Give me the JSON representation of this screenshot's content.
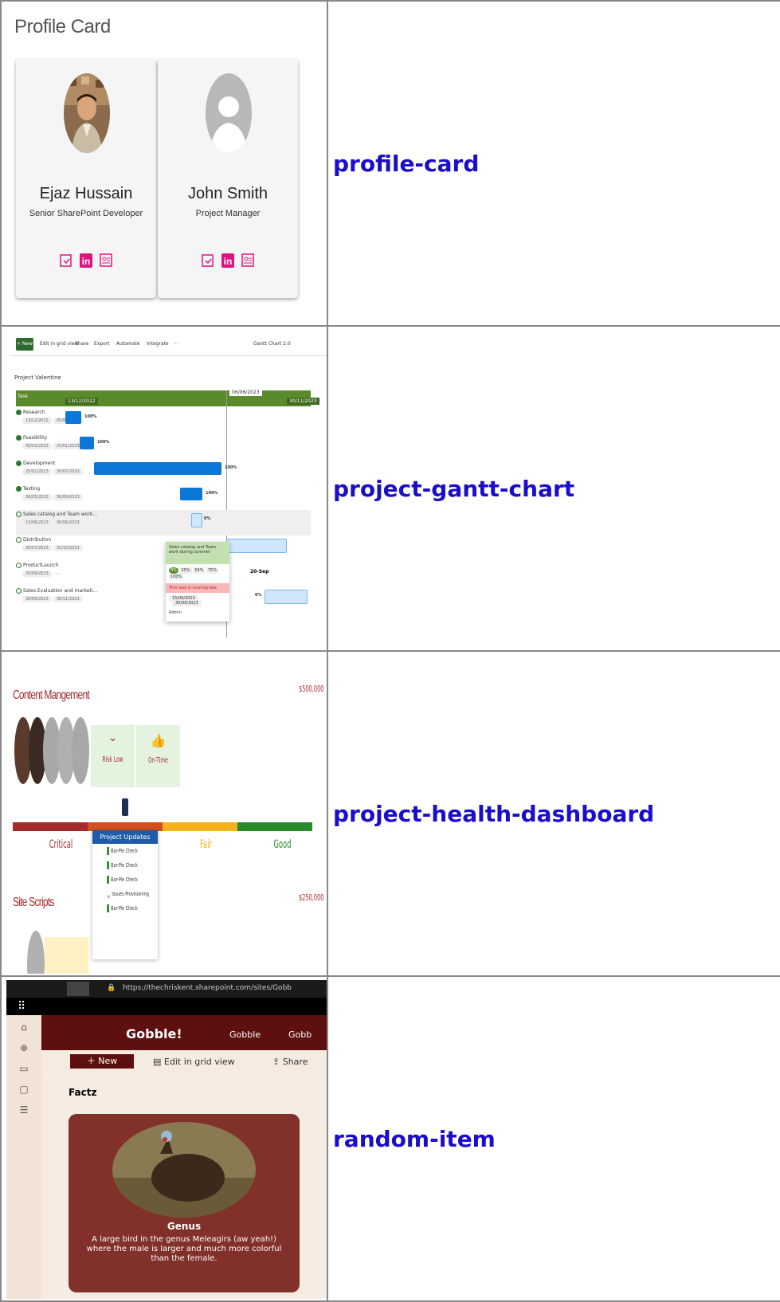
{
  "rows": [
    {
      "link": "profile-card"
    },
    {
      "link": "project-gantt-chart"
    },
    {
      "link": "project-health-dashboard"
    },
    {
      "link": "random-item"
    }
  ],
  "profile": {
    "title": "Profile Card",
    "cards": [
      {
        "name": "Ejaz Hussain",
        "role": "Senior SharePoint Developer"
      },
      {
        "name": "John Smith",
        "role": "Project Manager"
      }
    ]
  },
  "gantt": {
    "toolbar": {
      "new": "+ New",
      "edit": "Edit in grid view",
      "share": "Share",
      "export": "Export",
      "automate": "Automate",
      "integrate": "Integrate",
      "more": "···",
      "view": "Gantt Chart 2.0"
    },
    "project": "Project Valentine",
    "header": {
      "task": "Task",
      "d1": "13/12/2022",
      "d2": "06/06/2023",
      "d3": "30/11/2023"
    },
    "tasks": [
      {
        "name": "Research",
        "start": "13/12/2022",
        "end": "05/01/2023",
        "pct": "100%"
      },
      {
        "name": "Feasibility",
        "start": "05/01/2023",
        "end": "25/01/2023",
        "pct": "100%"
      },
      {
        "name": "Development",
        "start": "25/01/2023",
        "end": "30/07/2023",
        "pct": "100%"
      },
      {
        "name": "Testing",
        "start": "30/05/2023",
        "end": "30/06/2023",
        "pct": "100%"
      },
      {
        "name": "Sales catalog and Team work...",
        "start": "15/06/2023",
        "end": "30/06/2023",
        "pct": "0%"
      },
      {
        "name": "Distribution",
        "start": "30/07/2023",
        "end": "31/10/2023",
        "pct": ""
      },
      {
        "name": "ProductLaunch",
        "start": "20/09/2023",
        "end": "",
        "pct": ""
      },
      {
        "name": "Sales Evaluation and marketi...",
        "start": "30/09/2023",
        "end": "30/11/2023",
        "pct": "0%"
      }
    ],
    "milestone": "20-Sep",
    "popup": {
      "title": "Sales catalog and Team work during summer",
      "options": [
        "0%",
        "25%",
        "50%",
        "75%",
        "100%"
      ],
      "warning": "This task is running late",
      "start": "15/06/2023",
      "end": "30/06/2023",
      "owner": "Admin"
    }
  },
  "health": {
    "project1": {
      "title": "Content Mangement",
      "amount": "$500,000",
      "risk": "Risk Low",
      "time": "On-Time"
    },
    "scale": [
      "Critical",
      "Fair",
      "Good"
    ],
    "updates": {
      "title": "Project Updates",
      "lines": [
        "Bar-Pie Check",
        "Bar-Pie Check",
        "Bar-Pie Check",
        "Issues Provisioning",
        "Bar-Pie Check"
      ]
    },
    "project2": {
      "title": "Site Scripts",
      "amount": "$250,000"
    },
    "colors": {
      "critical": "#a52a2a",
      "poor": "#d2501c",
      "fair": "#f5b21c",
      "good": "#2a8a2a"
    }
  },
  "random": {
    "url": "https://thechriskent.sharepoint.com/sites/Gobb",
    "site": "Gobble!",
    "nav": [
      "Gobble",
      "Gobb"
    ],
    "cmd": {
      "new": "New",
      "edit": "Edit in grid view",
      "share": "Share"
    },
    "list": "Factz",
    "card_title": "Genus",
    "card_text": "A large bird in the genus Meleagirs (aw yeah!) where the male is larger and much more colorful than the female."
  }
}
